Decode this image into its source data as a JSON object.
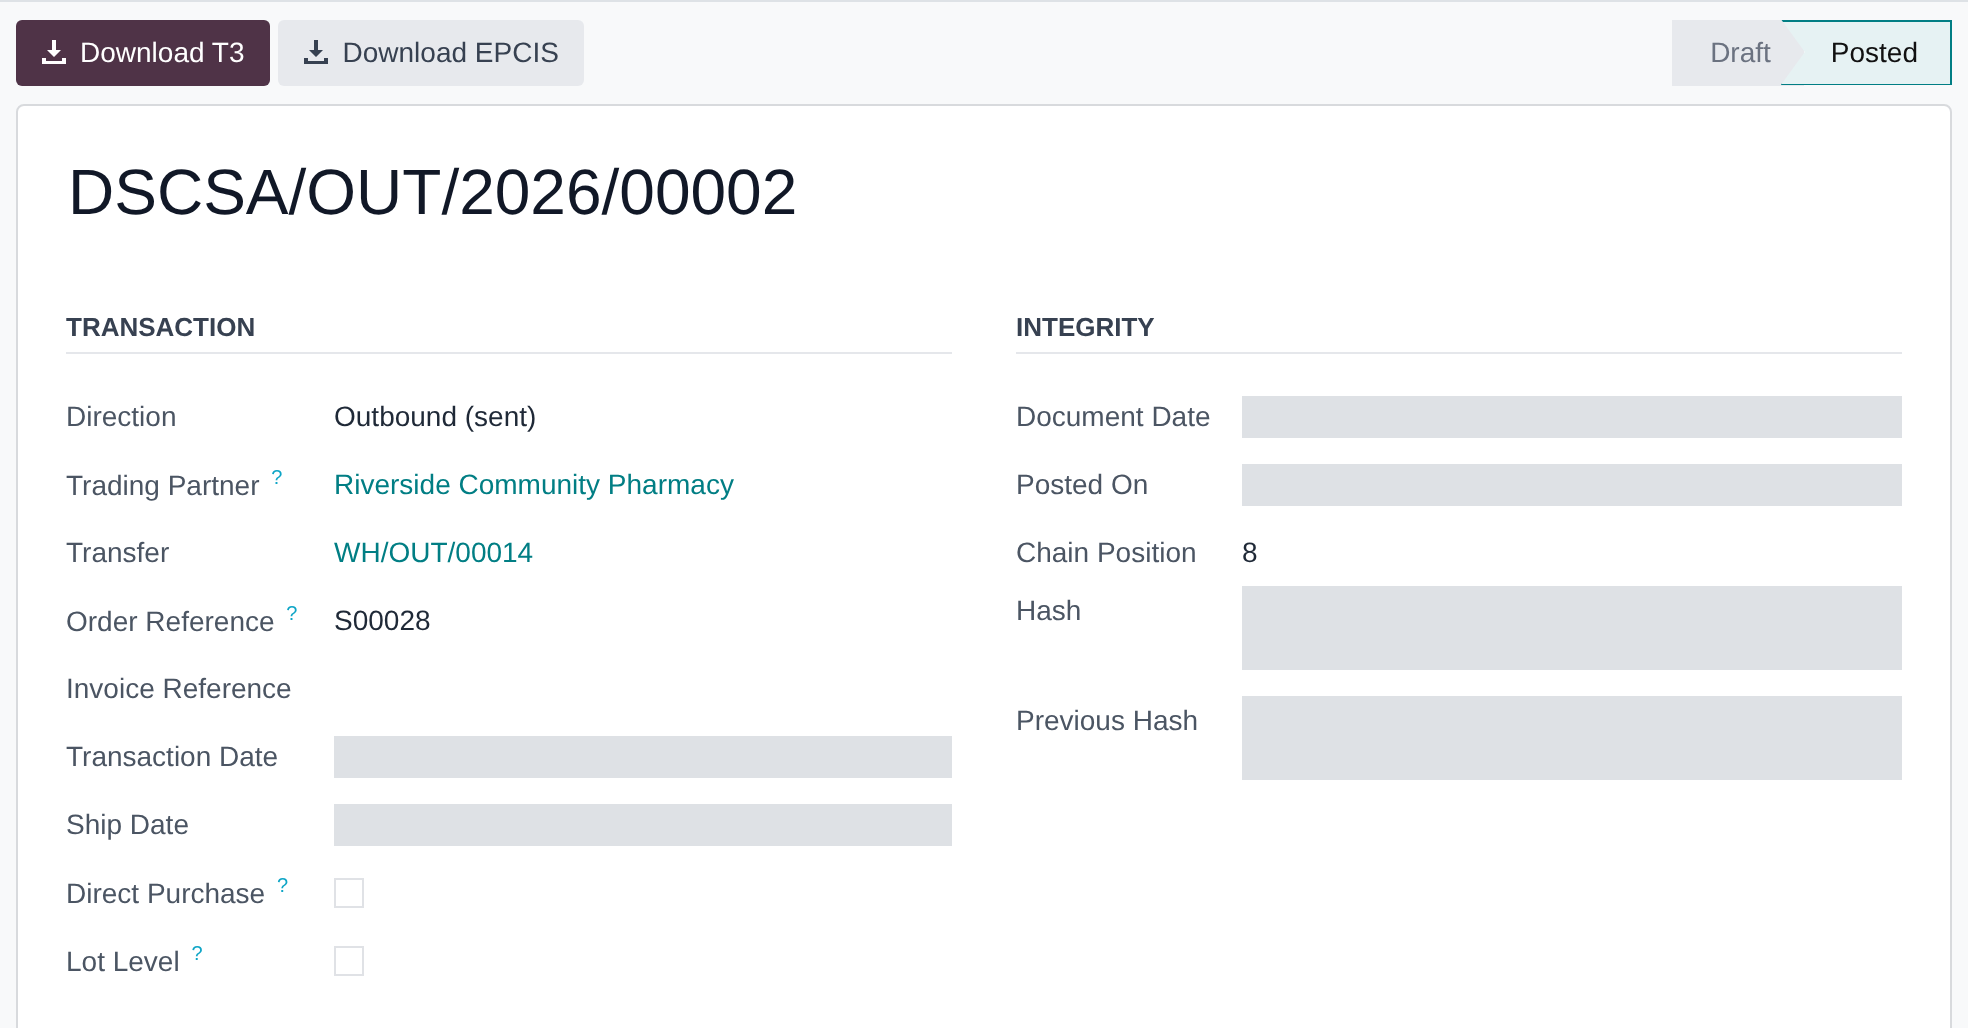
{
  "actions": [
    {
      "label": "Download T3",
      "primary": true
    },
    {
      "label": "Download EPCIS",
      "primary": false
    }
  ],
  "stages": [
    {
      "label": "Draft",
      "selected": false
    },
    {
      "label": "Posted",
      "selected": true
    }
  ],
  "title": "DSCSA/OUT/2026/00002",
  "groups": [
    {
      "heading": "TRANSACTION",
      "fields": [
        {
          "label": "Direction",
          "kind": "text",
          "value": "Outbound (sent)"
        },
        {
          "label": "Trading Partner",
          "help": "?",
          "kind": "link",
          "value": "Riverside Community Pharmacy"
        },
        {
          "label": "Transfer",
          "kind": "link",
          "value": "WH/OUT/00014"
        },
        {
          "label": "Order Reference",
          "help": "?",
          "kind": "text",
          "value": "S00028"
        },
        {
          "label": "Invoice Reference",
          "kind": "empty"
        },
        {
          "label": "Transaction Date",
          "kind": "blank"
        },
        {
          "label": "Ship Date",
          "kind": "blank"
        },
        {
          "label": "Direct Purchase",
          "help": "?",
          "kind": "checkbox",
          "checked": false
        },
        {
          "label": "Lot Level",
          "help": "?",
          "kind": "checkbox",
          "checked": false
        }
      ]
    },
    {
      "heading": "INTEGRITY",
      "fields": [
        {
          "label": "Document Date",
          "kind": "blank"
        },
        {
          "label": "Posted On",
          "kind": "blank"
        },
        {
          "label": "Chain Position",
          "kind": "text",
          "value": "8"
        },
        {
          "label": "Hash",
          "kind": "blank_tall"
        },
        {
          "label": "Previous Hash",
          "kind": "blank_tall"
        }
      ]
    }
  ]
}
